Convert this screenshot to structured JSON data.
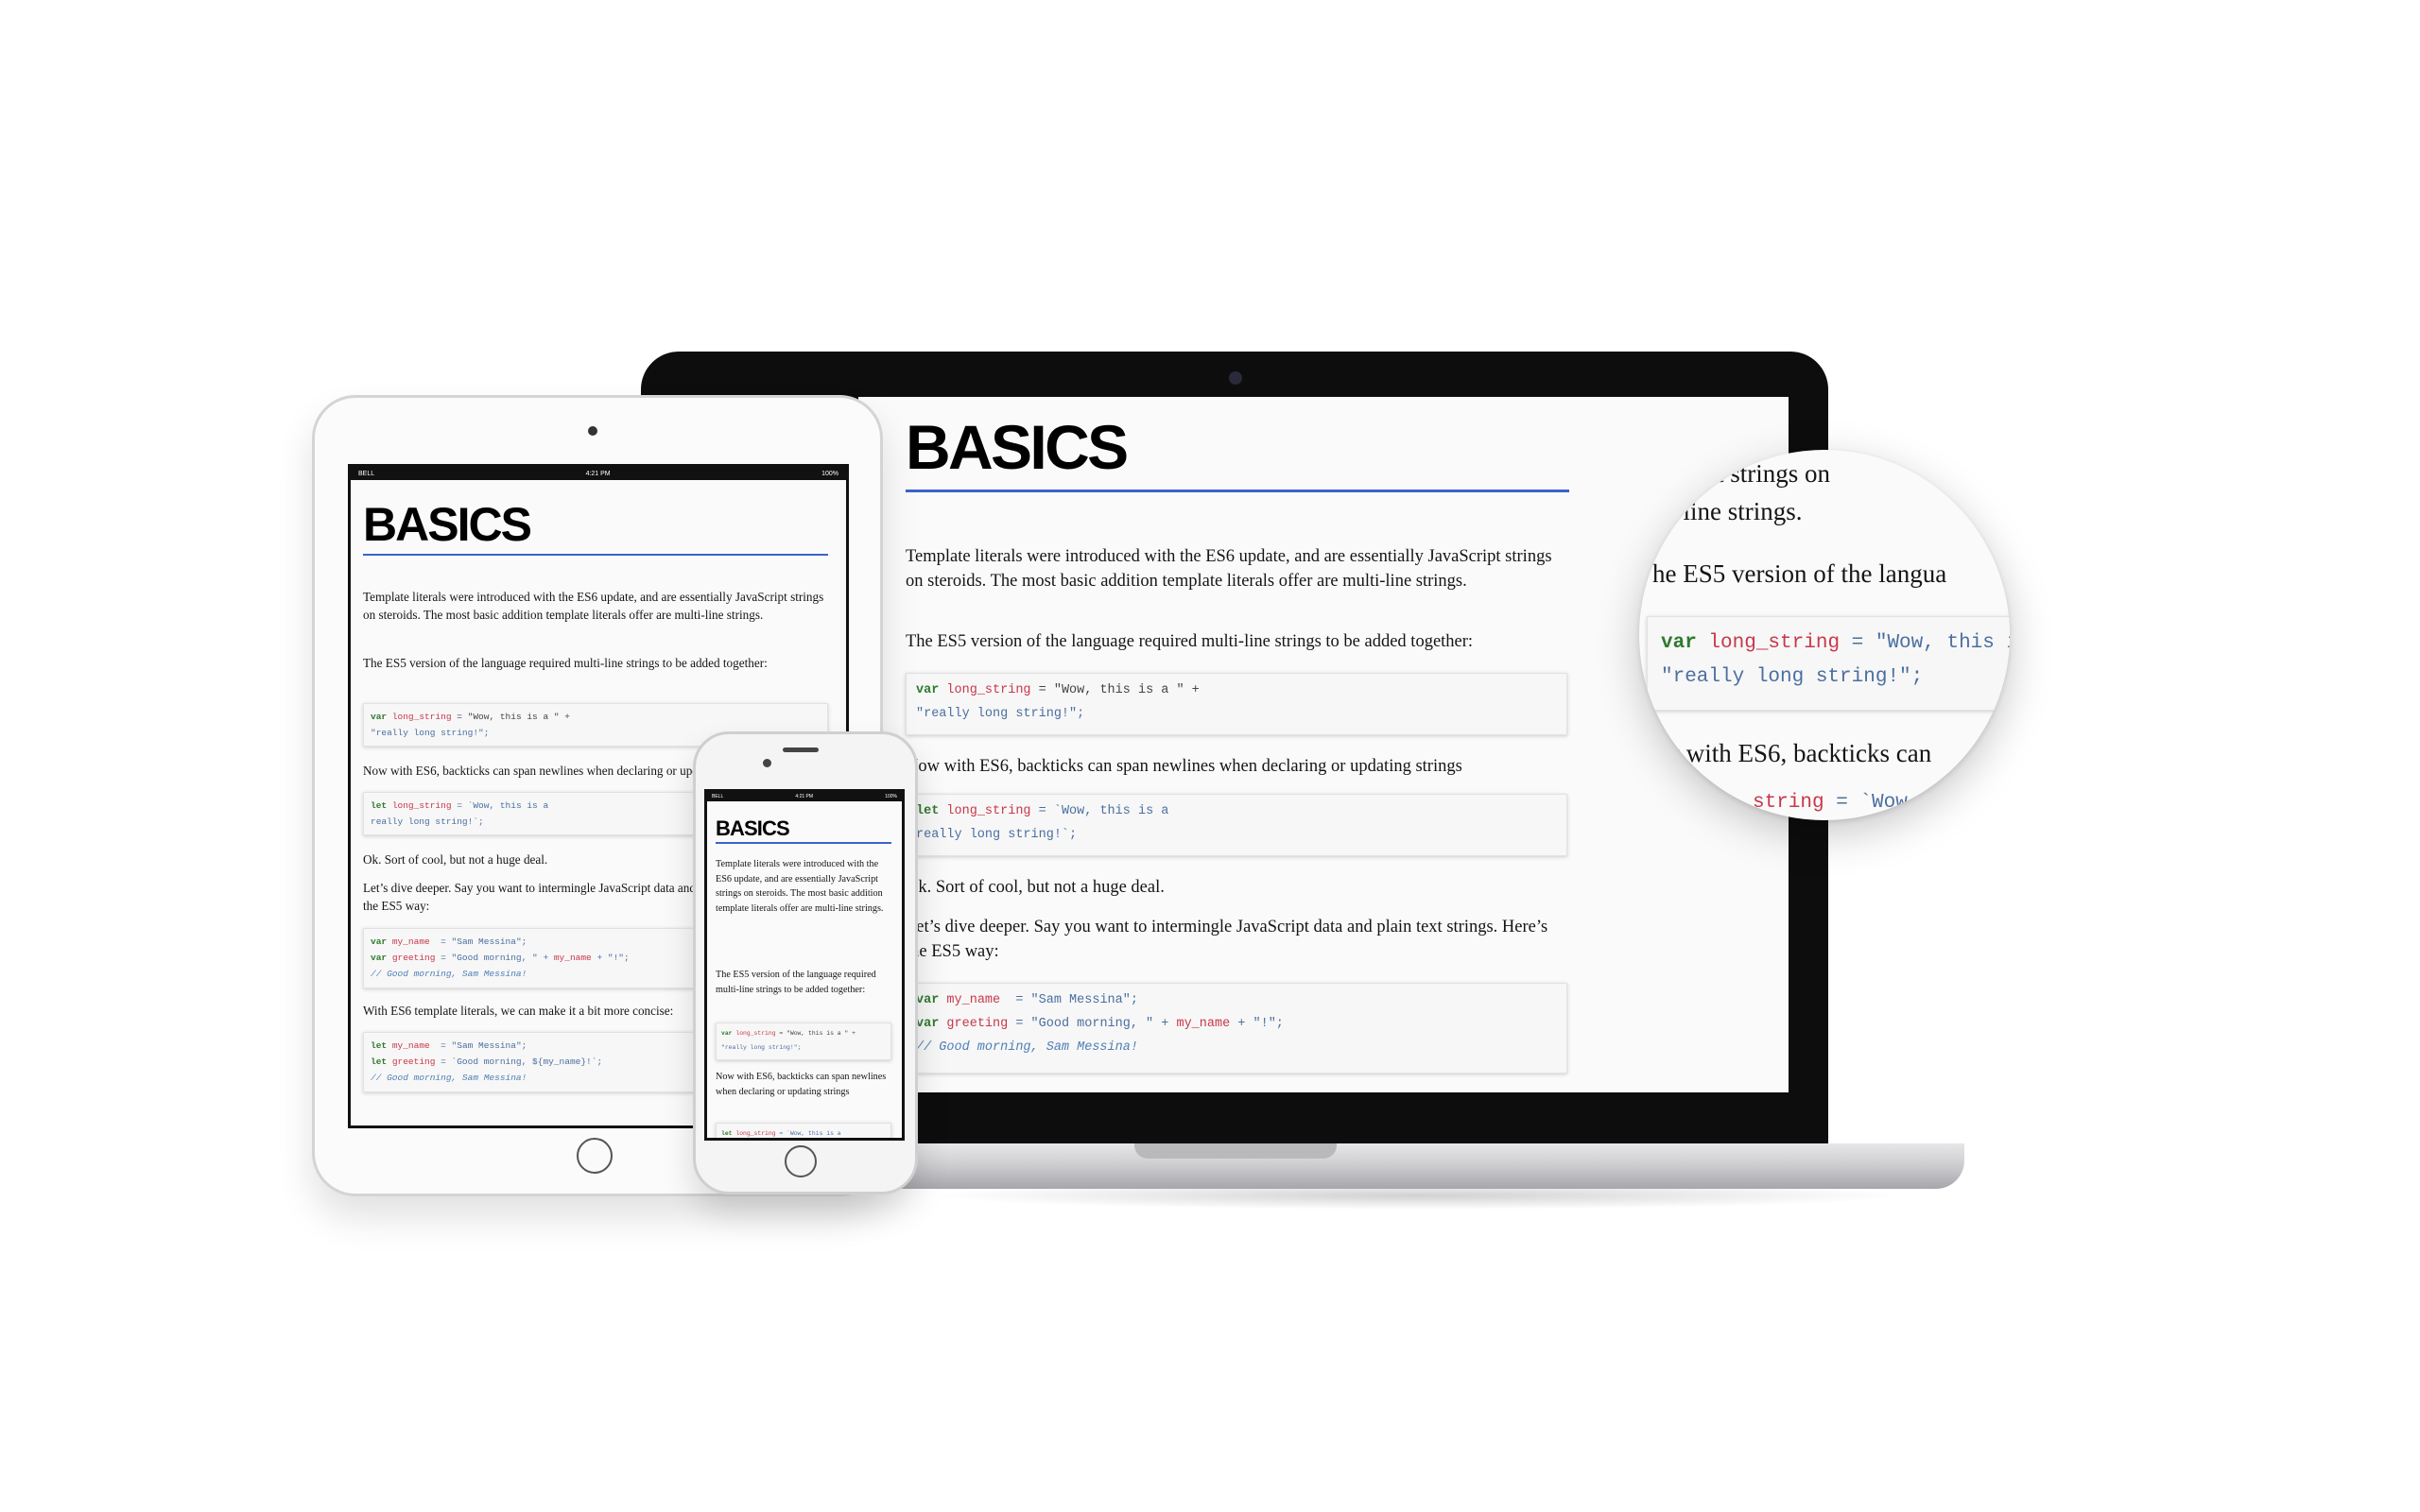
{
  "doc": {
    "heading": "BASICS",
    "p1": "Template literals were introduced with the ES6 update, and are essentially JavaScript strings on steroids. The most basic addition template literals offer are multi-line strings.",
    "p2": "The ES5 version of the language required multi-line strings to be added together:",
    "code1": {
      "l1_kw": "var",
      "l1_var": "long_string",
      "l1_rest": " = \"Wow, this is a \" +",
      "l2": "\"really long string!\";"
    },
    "p3": "Now with ES6, backticks can span newlines when declaring or updating strings",
    "code2": {
      "l1_kw": "let",
      "l1_var": "long_string",
      "l1_rest": " = `Wow, this is a",
      "l2": "really long string!`;"
    },
    "p4": "Ok. Sort of cool, but not a huge deal.",
    "p5": "Let’s dive deeper. Say you want to intermingle JavaScript data and plain text strings. Here’s the ES5 way:",
    "code3": {
      "l1_kw": "var",
      "l1_var": "my_name",
      "l1_rest": "  = \"Sam Messina\";",
      "l2_kw": "var",
      "l2_var": "greeting",
      "l2_rest_a": " = \"Good morning, \" + ",
      "l2_var2": "my_name",
      "l2_rest_b": " + \"!\";",
      "l3": "// Good morning, Sam Messina!"
    },
    "p6": "With ES6 template literals, we can make it a bit more concise:",
    "code4": {
      "l1_kw": "let",
      "l1_var": "my_name",
      "l1_rest": "  = \"Sam Messina\";",
      "l2_kw": "let",
      "l2_var": "greeting",
      "l2_rest": " = `Good morning, ${my_name}!`;",
      "l3": "// Good morning, Sam Messina!"
    }
  },
  "magnifier": {
    "line0": "t strings on",
    "line1": "i-line strings.",
    "line2": "he ES5 version of the langua",
    "code_l1_kw": "var",
    "code_l1_var": "long_string",
    "code_l1_rest": " = \"Wow, this is a",
    "code_l2": "\"really long string!\";",
    "line3": "ow with ES6, backticks can",
    "line4_var": "string",
    "line4_rest": " = `Wow"
  },
  "status": {
    "carrier": "BELL",
    "time": "4:21 PM",
    "battery": "100%"
  },
  "colors": {
    "accent": "#3b63c9",
    "keyword": "#2f7a2f",
    "variable": "#c8374a",
    "string": "#4a6fa0"
  }
}
